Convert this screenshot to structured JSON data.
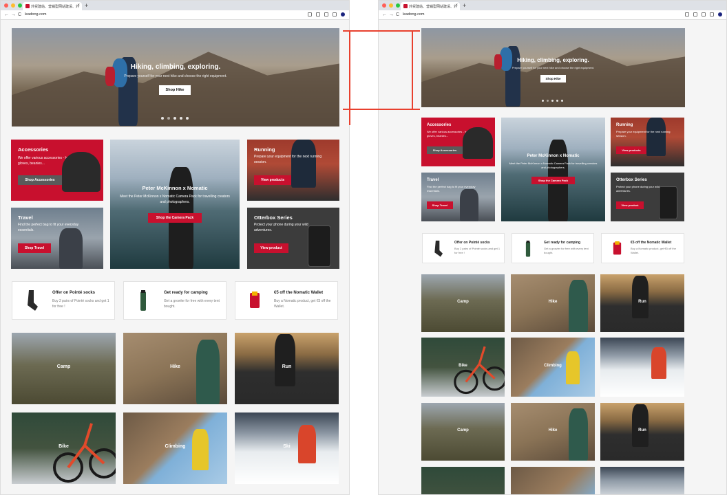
{
  "browser": {
    "tab_title": "外贸建站、营销型网站建设、外",
    "tab_close": "×",
    "new_tab": "+",
    "url": "leadong.com",
    "nav": {
      "back": "←",
      "forward": "→",
      "reload": "C"
    }
  },
  "hero": {
    "title": "Hiking, climbing, exploring.",
    "subtitle": "Prepare yourself for your next hike and choose the right equipment.",
    "button": "Shop Hike",
    "slides": 5
  },
  "cards": {
    "accessories": {
      "title": "Accessories",
      "text": "We offer various accessories - hats, gloves, beanies...",
      "button": "Shop Accessories"
    },
    "camera": {
      "title": "Peter McKinnon x Nomatic",
      "text": "Meet the Peter McKinnon x Nomatic Camera Pack for travelling creators and photographers.",
      "button": "Shop the Camera Pack"
    },
    "running": {
      "title": "Running",
      "text": "Prepare your equipment for the next running session.",
      "button": "View products"
    },
    "travel": {
      "title": "Travel",
      "text": "Find the perfect bag to fit your everyday essentials.",
      "button": "Shop Travel"
    },
    "otterbox": {
      "title": "Otterbox Series",
      "text": "Protect your phone during your wild adventures.",
      "button": "View product"
    }
  },
  "promos": [
    {
      "title": "Offer on Pointé socks",
      "text": "Buy 2 pairs of Pointé socks and get 1 for free !",
      "icon": "sock-icon"
    },
    {
      "title": "Get ready for camping",
      "text": "Get a growler for free with every tent bought.",
      "icon": "bottle-icon"
    },
    {
      "title": "€5 off the Nomatic Wallet",
      "text": "Buy a Nomatic product, get €5 off the Wallet.",
      "icon": "wallet-icon"
    }
  ],
  "categories": [
    "Camp",
    "Hike",
    "Run",
    "Bike",
    "Climbing",
    "Ski"
  ],
  "colors": {
    "accent": "#c8102e",
    "dark_card": "#3c3c3c",
    "annotation": "#e8402e"
  }
}
